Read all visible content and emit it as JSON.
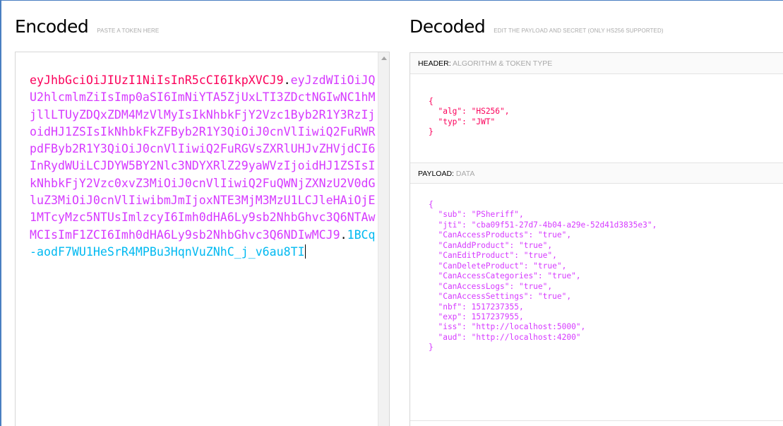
{
  "encoded": {
    "title": "Encoded",
    "hint": "PASTE A TOKEN HERE",
    "token_header": "eyJhbGciOiJIUzI1NiIsInR5cCI6IkpXVCJ9",
    "token_payload": "eyJzdWIiOiJQU2hlcmlmZiIsImp0aSI6ImNiYTA5ZjUxLTI3ZDctNGIwNC1hMjllLTUyZDQxZDM4MzVlMyIsIkNhbkFjY2Vzc1Byb2R1Y3RzIjoidHJ1ZSIsIkNhbkFkZFByb2R1Y3QiOiJ0cnVlIiwiQ2FuRWRpdFByb2R1Y3QiOiJ0cnVlIiwiQ2FuRGVsZXRlUHJvZHVjdCI6InRydWUiLCJDYW5BY2Nlc3NDYXRlZ29yaWVzIjoidHJ1ZSIsIkNhbkFjY2Vzc0xvZ3MiOiJ0cnVlIiwiQ2FuQWNjZXNzU2V0dGluZ3MiOiJ0cnVlIiwibmJmIjoxNTE3MjM3MzU1LCJleHAiOjE1MTcyMzc5NTUsImlzcyI6Imh0dHA6Ly9sb2NhbGhvc3Q6NTAwMCIsImF1ZCI6Imh0dHA6Ly9sb2NhbGhvc3Q6NDIwMCJ9",
    "token_signature": "1BCq-aodF7WU1HeSrR4MPBu3HqnVuZNhC_j_v6au8TI"
  },
  "decoded": {
    "title": "Decoded",
    "hint": "EDIT THE PAYLOAD AND SECRET (ONLY HS256 SUPPORTED)",
    "header_label": "HEADER:",
    "header_sub": "ALGORITHM & TOKEN TYPE",
    "payload_label": "PAYLOAD:",
    "payload_sub": "DATA",
    "header_json": "{\n  \"alg\": \"HS256\",\n  \"typ\": \"JWT\"\n}",
    "payload_json": "{\n  \"sub\": \"PSheriff\",\n  \"jti\": \"cba09f51-27d7-4b04-a29e-52d41d3835e3\",\n  \"CanAccessProducts\": \"true\",\n  \"CanAddProduct\": \"true\",\n  \"CanEditProduct\": \"true\",\n  \"CanDeleteProduct\": \"true\",\n  \"CanAccessCategories\": \"true\",\n  \"CanAccessLogs\": \"true\",\n  \"CanAccessSettings\": \"true\",\n  \"nbf\": 1517237355,\n  \"exp\": 1517237955,\n  \"iss\": \"http://localhost:5000\",\n  \"aud\": \"http://localhost:4200\"\n}"
  },
  "colors": {
    "header": "#fb015b",
    "payload": "#d63aff",
    "signature": "#00b9f1"
  }
}
